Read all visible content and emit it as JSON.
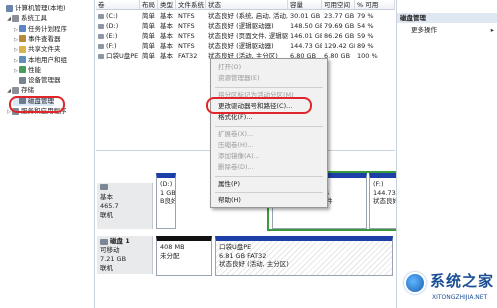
{
  "tree": [
    {
      "label": "计算机管理(本地)",
      "expand": "",
      "icon": "computer-icon",
      "color": "#6b86a8"
    },
    {
      "label": "系统工具",
      "expand": "◢",
      "icon": "tools-icon",
      "color": "#8a8f98"
    },
    {
      "label": "任务计划程序",
      "expand": "▷",
      "icon": "clock-icon",
      "color": "#5f86c4"
    },
    {
      "label": "事件查看器",
      "expand": "▷",
      "icon": "event-icon",
      "color": "#b58a3c"
    },
    {
      "label": "共享文件夹",
      "expand": "▷",
      "icon": "folder-icon",
      "color": "#d8b24a"
    },
    {
      "label": "本地用户和组",
      "expand": "▷",
      "icon": "users-icon",
      "color": "#5f8fb8"
    },
    {
      "label": "性能",
      "expand": "▷",
      "icon": "performance-icon",
      "color": "#4a9c5a"
    },
    {
      "label": "设备管理器",
      "expand": "",
      "icon": "device-icon",
      "color": "#7a8290"
    },
    {
      "label": "存储",
      "expand": "◢",
      "icon": "storage-icon",
      "color": "#8a8f98"
    },
    {
      "label": "磁盘管理",
      "expand": "",
      "icon": "disk-icon",
      "color": "#6d7b8f"
    },
    {
      "label": "服务和应用程序",
      "expand": "▷",
      "icon": "services-icon",
      "color": "#7b8b99"
    }
  ],
  "columns": [
    "卷",
    "布局",
    "类型",
    "文件系统",
    "状态",
    "容量",
    "可用空间",
    "% 可用"
  ],
  "volumes": [
    {
      "name": "(C:)",
      "layout": "简单",
      "type": "基本",
      "fs": "NTFS",
      "status": "状态良好 (系统, 启动, 活动, 主分区)",
      "cap": "30.01 GB",
      "free": "23.77 GB",
      "pct": "79 %"
    },
    {
      "name": "(D:)",
      "layout": "简单",
      "type": "基本",
      "fs": "NTFS",
      "status": "状态良好 (逻辑驱动器)",
      "cap": "148.50 GB",
      "free": "79.69 GB",
      "pct": "54 %"
    },
    {
      "name": "(E:)",
      "layout": "简单",
      "type": "基本",
      "fs": "NTFS",
      "status": "状态良好 (页面文件, 逻辑驱动器)",
      "cap": "146.01 GB",
      "free": "86.26 GB",
      "pct": "59 %"
    },
    {
      "name": "(F:)",
      "layout": "简单",
      "type": "基本",
      "fs": "NTFS",
      "status": "状态良好 (逻辑驱动器)",
      "cap": "144.73 GB",
      "free": "129.42 GB",
      "pct": "89 %"
    },
    {
      "name": "口袋U盘PE",
      "layout": "简单",
      "type": "基本",
      "fs": "FAT32",
      "status": "状态良好 (活动, 主分区)",
      "cap": "6.80 GB",
      "free": "6.80 GB",
      "pct": "100 %"
    }
  ],
  "context_menu": [
    {
      "label": "打开(O)",
      "disabled": true
    },
    {
      "label": "资源管理器(E)",
      "disabled": true
    },
    {
      "sep": true
    },
    {
      "label": "将分区标记为活动分区(M)",
      "disabled": true
    },
    {
      "label": "更改驱动器号和路径(C)...",
      "disabled": false
    },
    {
      "label": "格式化(F)...",
      "disabled": false
    },
    {
      "sep": true
    },
    {
      "label": "扩展卷(X)...",
      "disabled": true
    },
    {
      "label": "压缩卷(H)...",
      "disabled": true
    },
    {
      "label": "添加镜像(A)...",
      "disabled": true
    },
    {
      "label": "删除卷(D)...",
      "disabled": true
    },
    {
      "sep": true
    },
    {
      "label": "属性(P)",
      "disabled": false
    },
    {
      "sep": true
    },
    {
      "label": "帮助(H)",
      "disabled": false
    }
  ],
  "disk0": {
    "label_lines": [
      "基本",
      "465.7",
      "联机"
    ],
    "partitions": [
      {
        "lines": [
          "",
          "",
          "",
          ""
        ]
      },
      {
        "lines": [
          "",
          "",
          "",
          ""
        ]
      },
      {
        "lines": [
          "(E:)",
          "145.01 GB NTFS",
          "状态良好 (页面文件",
          "",
          ""
        ]
      },
      {
        "lines": [
          "(F:)",
          "144.73 GB NTFS",
          "状态良好 (逻辑驱动",
          "",
          ""
        ]
      }
    ],
    "partial_d": [
      "(D:)",
      "1 GB NTFS",
      "B良好 (逻辑"
    ]
  },
  "disk1": {
    "title": "磁盘 1",
    "type": "可移动",
    "size": "7.21 GB",
    "status": "联机",
    "unalloc": {
      "size": "408 MB",
      "label": "未分配"
    },
    "pe": {
      "name": "口袋U盘PE",
      "size": "6.81 GB FAT32",
      "status": "状态良好 (活动, 主分区)"
    }
  },
  "actions": {
    "header": "磁盘管理",
    "more": "更多操作"
  },
  "watermark": {
    "title": "系统之家",
    "url": "XITONGZHIJIA.NET"
  }
}
